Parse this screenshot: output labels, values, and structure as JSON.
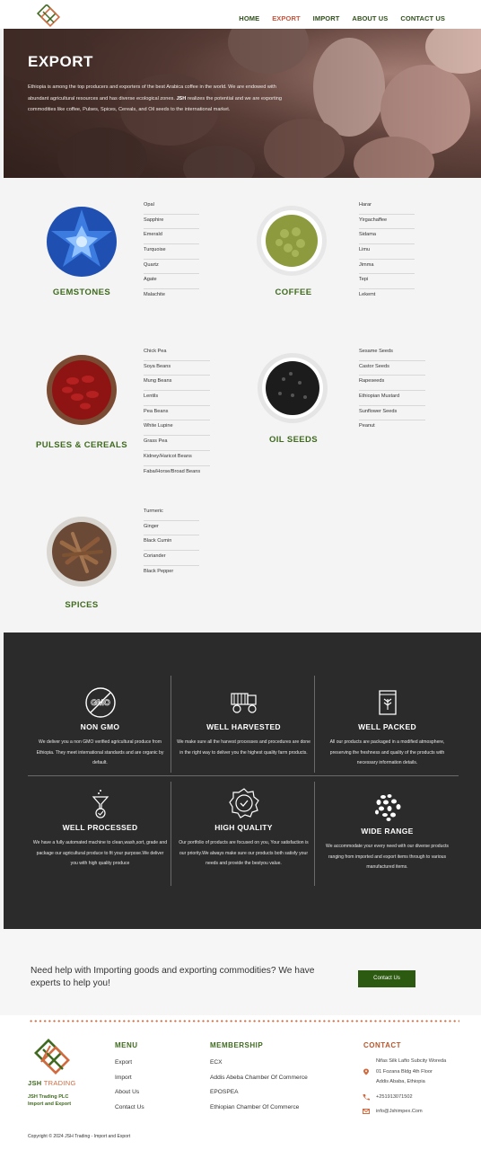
{
  "nav": {
    "links": [
      {
        "label": "HOME",
        "active": false
      },
      {
        "label": "EXPORT",
        "active": true
      },
      {
        "label": "IMPORT",
        "active": false
      },
      {
        "label": "ABOUT US",
        "active": false
      },
      {
        "label": "CONTACT US",
        "active": false
      }
    ]
  },
  "hero": {
    "title": "EXPORT",
    "text_1": "Ethiopia is among the top producers and exporters of the best Arabica coffee in the world. We are endowed with abundant agricultural resources and has diverse ecological zones. ",
    "text_bold": "JSH",
    "text_2": " realizes the potential and we are exporting commodities like coffee, Pulses, Spices, Cereals, and Oil seeds to the international market."
  },
  "products": {
    "gemstones": {
      "title": "GEMSTONES",
      "items": [
        "Opal",
        "Sapphire",
        "Emerald",
        "Turquoise",
        "Quartz",
        "Agate",
        "Malachite"
      ]
    },
    "coffee": {
      "title": "COFFEE",
      "items": [
        "Harar",
        "Yirgachaffee",
        "Sidama",
        "Limu",
        "Jimma",
        "Tepi",
        "Lekemt"
      ]
    },
    "pulses": {
      "title": "PULSES & CEREALS",
      "items": [
        "Chick Pea",
        "Soya Beans",
        "Mung Beans",
        "Lentils",
        "Pea Beans",
        "White Lupine",
        "Grass Pea",
        "Kidney/Haricot Beans",
        "Faba/Horse/Broad Beans"
      ]
    },
    "oilseeds": {
      "title": "OIL SEEDS",
      "items": [
        "Sesame Seeds",
        "Castor Seeds",
        "Rapeseeds",
        "Ethiopian Mustard",
        "Sunflower Seeds",
        "Peanut"
      ]
    },
    "spices": {
      "title": "SPICES",
      "items": [
        "Turmeric",
        "Ginger",
        "Black Cumin",
        "Coriander",
        "Black Pepper"
      ]
    }
  },
  "features": [
    {
      "icon": "gmo-icon",
      "title": "NON GMO",
      "text": "We deliver you a non GMO verified agricultural produce from Ethiopia. They meet international standards and are organic by default."
    },
    {
      "icon": "harvester-icon",
      "title": "WELL HARVESTED",
      "text": "We make sure all the harvest processes and procedures are done in the right way to deliver you the highest quality farm products."
    },
    {
      "icon": "package-icon",
      "title": "WELL PACKED",
      "text": "All our products are packaged in a modified atmosphere, preserving the freshness and quality of the products with necessary information details."
    },
    {
      "icon": "funnel-icon",
      "title": "WELL PROCESSED",
      "text": "We have a fully automated machine to clean,wash,sort, grade and package our agricultural produce to fit your purpose.We deliver you with high quality produce"
    },
    {
      "icon": "quality-badge-icon",
      "title": "HIGH QUALITY",
      "text": "Our portfolio of products are focused on you, Your satisfaction is our priority.We always make sure our products both satisfy your needs and provide the bestyou value."
    },
    {
      "icon": "variety-icon",
      "title": "WIDE RANGE",
      "text": "We accommodate your every need with our diverse products ranging from imported and export items through to various manufactured items."
    }
  ],
  "cta": {
    "text": "Need help with Importing goods and exporting commodities? We have experts to help you!",
    "button": "Contact Us"
  },
  "footer": {
    "brand_main": "JSH",
    "brand_accent": " TRADING",
    "company_line1": "JSH Trading PLC",
    "company_line2": "Import and Export",
    "menu": {
      "title": "MENU",
      "items": [
        "Export",
        "Import",
        "About Us",
        "Contact Us"
      ]
    },
    "membership": {
      "title": "MEMBERSHIP",
      "items": [
        "ECX",
        "Addis Abeba Chamber Of Commerce",
        "EPOSPEA",
        "Ethiopian Chamber Of Commerce"
      ]
    },
    "contact": {
      "title": "CONTACT",
      "address_line0": "Nifas Silk Lafto Subcity Woreda",
      "address_line1": "01 Fozana Bldg 4th Floor",
      "address_line2": "Addis Ababa, Ethiopia",
      "phone": "+251913071502",
      "email": "info@Jshimpex.Com"
    },
    "copyright": "Copyright © 2024 JSH Trading - Import and Export"
  },
  "colors": {
    "brand_green": "#3f6a1f",
    "accent_orange": "#c8553d",
    "dark_section": "#2b2b2b",
    "button_green": "#2c5a10"
  }
}
